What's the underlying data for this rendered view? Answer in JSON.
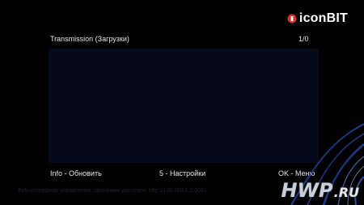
{
  "brand": {
    "name": "iconBIT",
    "accent": "#d8322c"
  },
  "header": {
    "title": "Transmission (Загрузки)",
    "page_counter": "1/0"
  },
  "list": {
    "items": []
  },
  "footer": {
    "refresh_label": "Info - Обновить",
    "settings_label": "5 - Настройки",
    "menu_label": "OK - Меню"
  },
  "hint_text": "Веб-интерфейс управления закачками доступен: http://192.168.1.2:9091",
  "watermark": {
    "main": "HWP",
    "suffix": ".RU"
  },
  "colors": {
    "background": "#000000",
    "panel": "#070a1a",
    "text": "#e6e6e6",
    "swirl": "#2a5fd6"
  }
}
